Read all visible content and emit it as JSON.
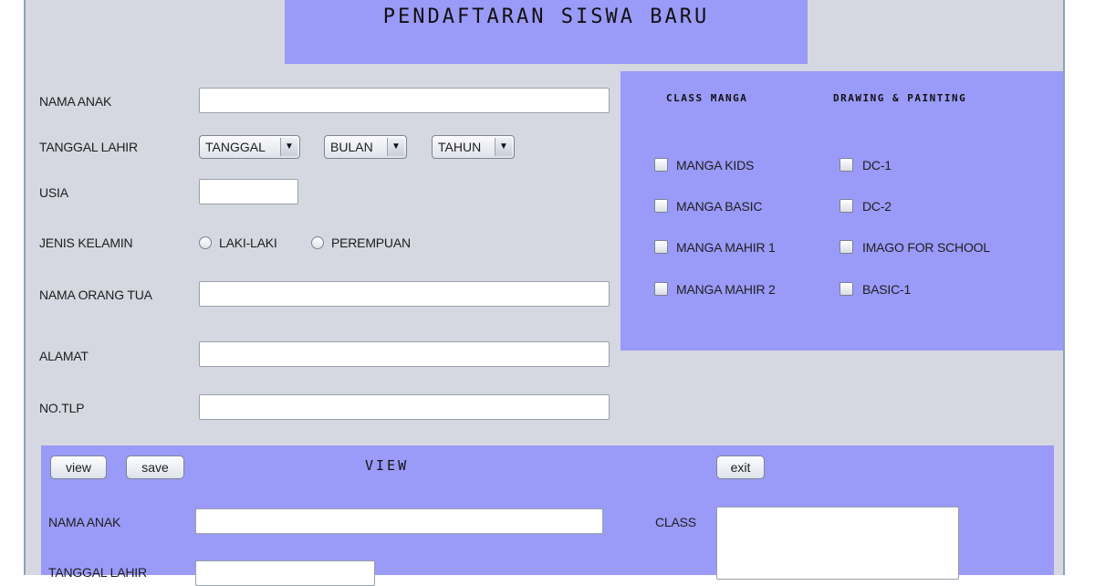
{
  "header": {
    "title": "PENDAFTARAN SISWA BARU"
  },
  "form": {
    "nama_anak_label": "NAMA ANAK",
    "tanggal_lahir_label": "TANGGAL LAHIR",
    "tanggal_combo": "TANGGAL",
    "bulan_combo": "BULAN",
    "tahun_combo": "TAHUN",
    "usia_label": "USIA",
    "jenis_kelamin_label": "JENIS KELAMIN",
    "radio_laki": "LAKI-LAKI",
    "radio_perempuan": "PEREMPUAN",
    "nama_orang_tua_label": "NAMA ORANG TUA",
    "alamat_label": "ALAMAT",
    "no_tlp_label": "NO.TLP"
  },
  "classes": {
    "manga_header": "CLASS MANGA",
    "drawing_header": "DRAWING & PAINTING",
    "manga_items": [
      "MANGA KIDS",
      "MANGA BASIC",
      "MANGA MAHIR 1",
      "MANGA MAHIR 2"
    ],
    "drawing_items": [
      "DC-1",
      "DC-2",
      "IMAGO FOR SCHOOL",
      "BASIC-1"
    ]
  },
  "view": {
    "view_button": "view",
    "save_button": "save",
    "title": "VIEW",
    "exit_button": "exit",
    "nama_anak_label": "NAMA ANAK",
    "tanggal_lahir_label": "TANGGAL LAHIR",
    "class_label": "CLASS"
  },
  "colors": {
    "panel_bg": "#d5d8e0",
    "accent_box": "#9a9af8"
  }
}
